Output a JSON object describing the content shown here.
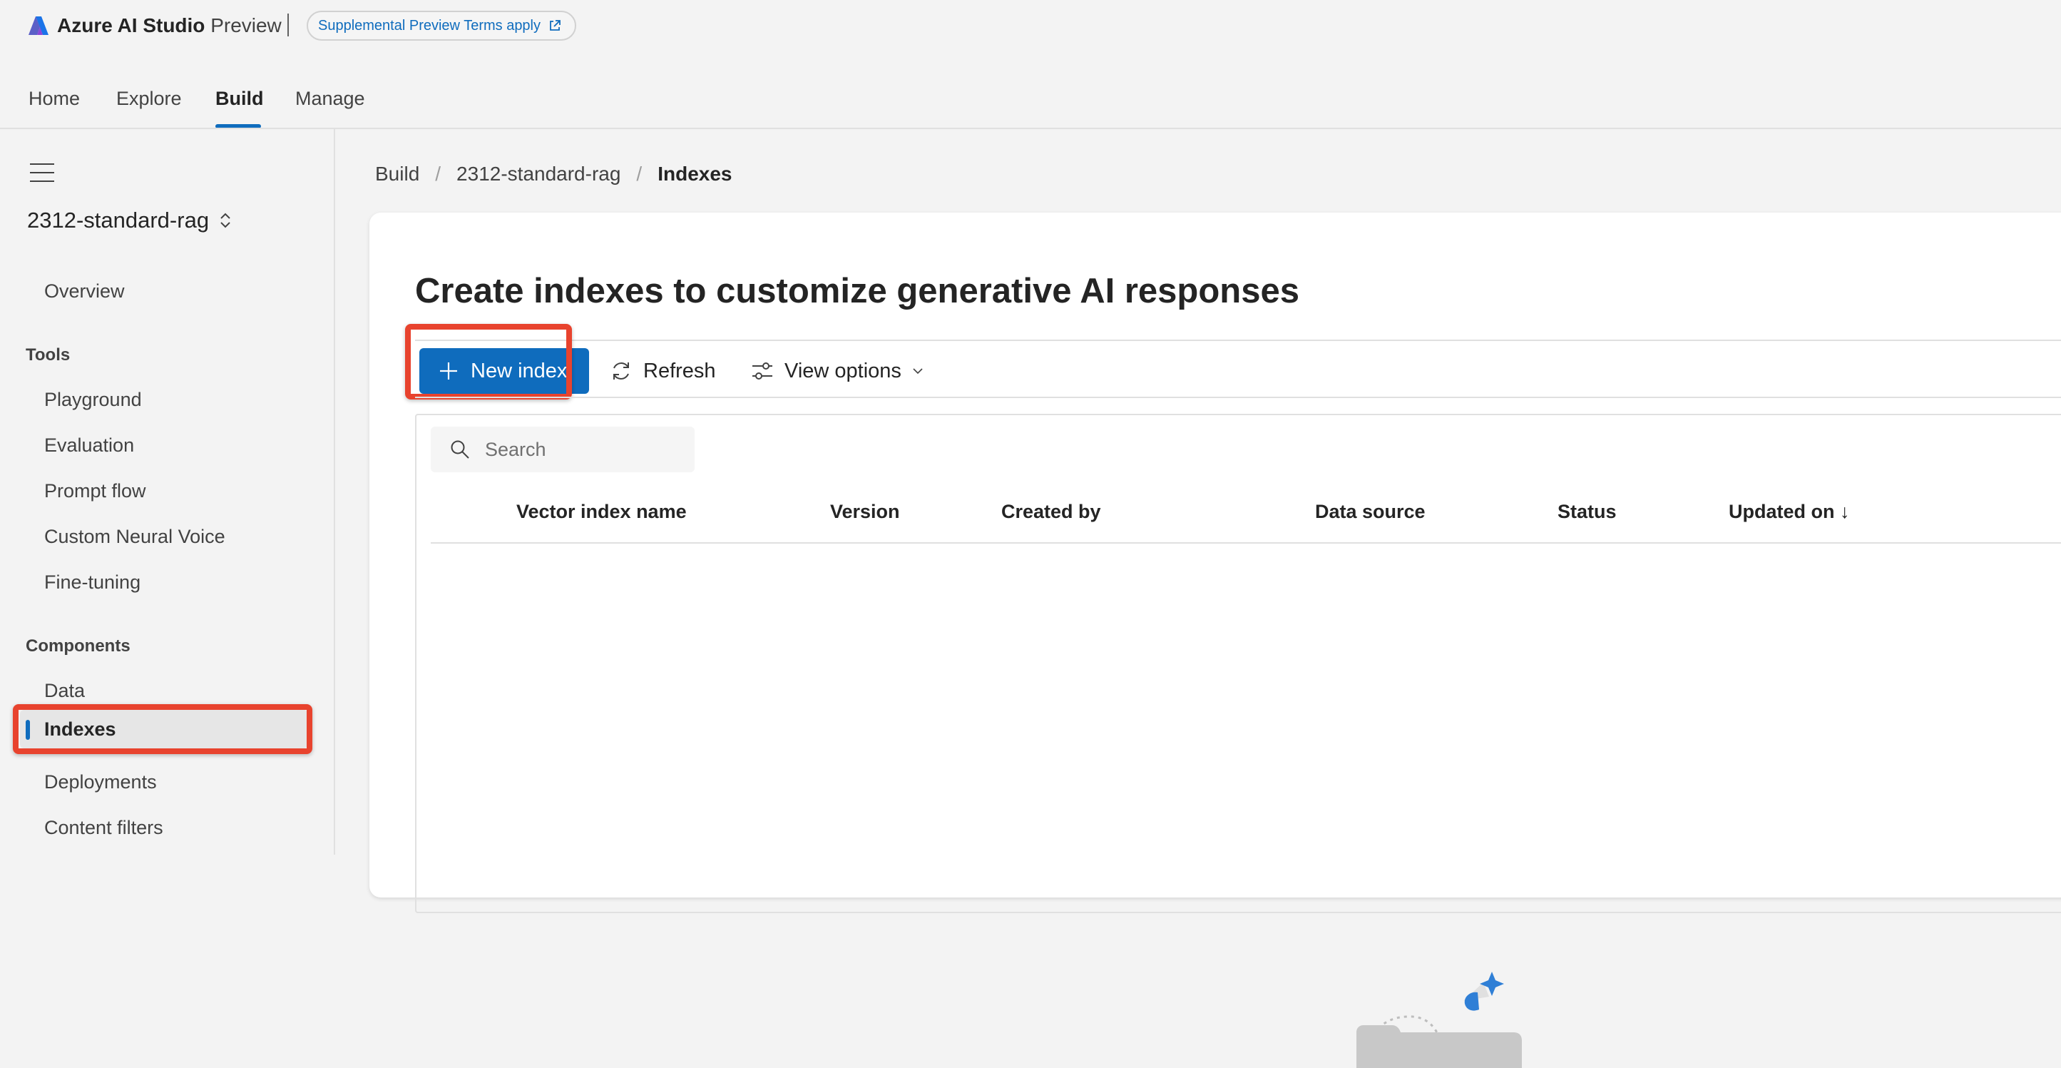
{
  "app": {
    "name": "Azure AI Studio",
    "suffix": "Preview",
    "terms_label": "Supplemental Preview Terms apply",
    "logo_icon": "azure-ai-logo",
    "accent": "#0f6cbd"
  },
  "nav": {
    "tabs": [
      {
        "label": "Home"
      },
      {
        "label": "Explore"
      },
      {
        "label": "Build"
      },
      {
        "label": "Manage"
      }
    ],
    "active": "Build"
  },
  "sidebar": {
    "project": "2312-standard-rag",
    "overview": "Overview",
    "tools_heading": "Tools",
    "tools": [
      "Playground",
      "Evaluation",
      "Prompt flow",
      "Custom Neural Voice",
      "Fine-tuning"
    ],
    "components_heading": "Components",
    "components": [
      "Data",
      "Indexes",
      "Deployments",
      "Content filters"
    ],
    "selected": "Indexes"
  },
  "breadcrumb": [
    "Build",
    "2312-standard-rag",
    "Indexes"
  ],
  "main": {
    "title": "Create indexes to customize generative AI responses",
    "toolbar": {
      "new_index": "New index",
      "refresh": "Refresh",
      "view_options": "View options"
    },
    "search": {
      "placeholder": "Search"
    },
    "columns": [
      "Vector index name",
      "Version",
      "Created by",
      "Data source",
      "Status",
      "Updated on ↓"
    ]
  },
  "highlight_color": "#e8432e"
}
